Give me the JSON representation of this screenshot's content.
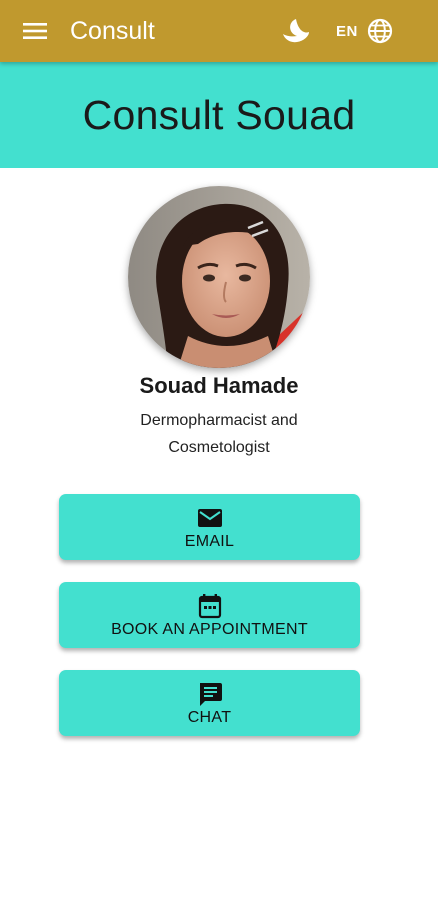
{
  "app_bar": {
    "title": "Consult",
    "menu_icon": "menu-icon",
    "theme_icon": "moon-icon",
    "language_code": "EN",
    "language_icon": "globe-icon",
    "background_color": "#c0992e"
  },
  "header": {
    "title": "Consult Souad",
    "background_color": "#43e0cf"
  },
  "profile": {
    "name": "Souad Hamade",
    "role_line1": "Dermopharmacist and",
    "role_line2": "Cosmetologist"
  },
  "actions": [
    {
      "label": "EMAIL",
      "icon": "email-icon"
    },
    {
      "label": "BOOK AN APPOINTMENT",
      "icon": "calendar-icon"
    },
    {
      "label": "CHAT",
      "icon": "chat-icon"
    }
  ],
  "accent_color": "#43e0cf"
}
